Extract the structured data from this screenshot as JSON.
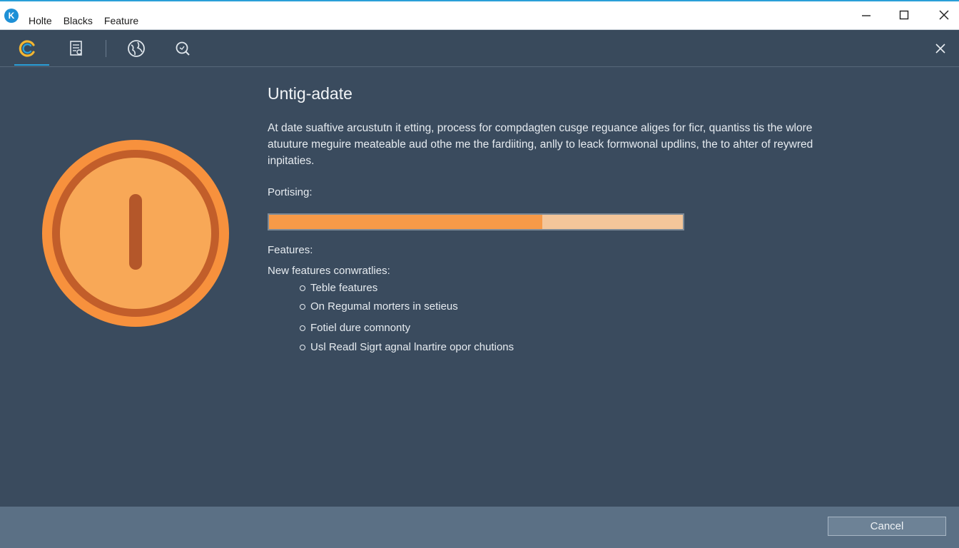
{
  "titlebar": {
    "logo_letter": "K",
    "menu": [
      "Holte",
      "Blacks",
      "Feature"
    ]
  },
  "toolbar": {
    "icons": [
      "refresh-icon",
      "document-icon",
      "globe-icon",
      "search-icon"
    ],
    "close_icon": "close-icon"
  },
  "main": {
    "title": "Untig-adate",
    "description": "At date suaftive arcustutn it etting, process for compdagten cusge reguance aliges for ficr, quantiss tis the wlore atuuture meguire meateable aud othe me the fardiiting, anlly to leack formwonal updlins, the to ahter of reywred inpitaties.",
    "progress_label": "Portising:",
    "progress_value": 0.66,
    "features_label": "Features:",
    "features_intro": "New features conwratlies:",
    "features": [
      "Teble features",
      "On Regumal morters in setieus",
      "Fotiel dure comnonty",
      "Usl Readl Sigrt agnal lnartire opor chutions"
    ]
  },
  "footer": {
    "cancel_label": "Cancel"
  },
  "colors": {
    "accent": "#2a9fd8",
    "progress_fill": "#f79a48",
    "progress_track": "#f4c69a",
    "hero_orange": "#f7913d"
  }
}
